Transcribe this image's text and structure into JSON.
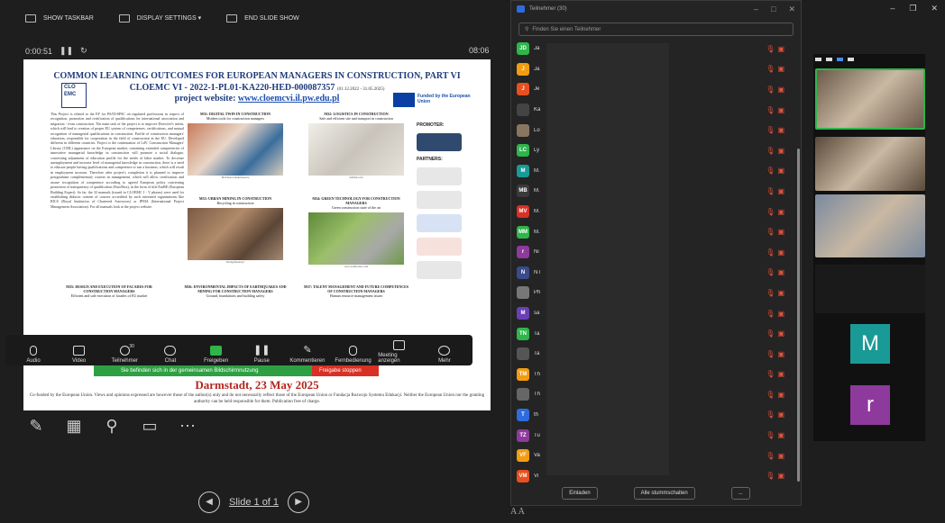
{
  "toolbar": {
    "show_taskbar": "SHOW TASKBAR",
    "display_settings": "DISPLAY SETTINGS ▾",
    "end_slide_show": "END SLIDE SHOW"
  },
  "timer": {
    "elapsed": "0:00:51",
    "clock": "08:06"
  },
  "slide": {
    "title": "COMMON LEARNING OUTCOMES FOR EUROPEAN MANAGERS IN CONSTRUCTION, PART VI",
    "subtitle": "CLOEMC VI - 2022-1-PL01-KA220-HED-000087357",
    "subtitle_dates": "(01.12.2022 - 31.05.2025)",
    "website_prefix": "project website: ",
    "website": "www.cloemcvi.il.pw.edu.pl",
    "logo_text": "CLO EMC",
    "eu_text": "Funded by the European Union",
    "body_text": "This Project is related to the EF for PS/05/SPSC on regulated professions in respect of recognition, promotion and certification of qualifications for international association and migration - from construction. The main task of the project is to improve Directive's intent, which will lead to creation of proper EU system of competences, certifications, and mutual recognition of managerial qualifications in construction. Profile of construction managers' education, responsible for cooperation in the field of construction in the EU. Developed different in different countries. Project is the continuation of LdV. Construction Managers' Library (CML) appearance on the European market, containing extended competencies of innovative managerial knowledge in construction will promote a social dialogue, concerning adjustment of education profile for the needs of labor market. To decrease unemployment and increase level of managerial knowledge in construction, there is a need to educate people having qualifications and competence to run a business, which will result in employment increase. Therefore after project's completion it is planned to improve postgraduate complementary courses in management, which will allow certification and assure recognition of competence according to agreed European policy concerning promotion of transparency of qualification (EuroPass), in the form of title EurBE (European Building Expert). So far, the 32 manuals (issued in CLOEMC I - V phases) were used for establishing didactic content of courses accredited by such esteemed organizations like RICS (Royal Institution of Chartered Surveyors) or IPMA (International Project Management Association). For all manuals look at the project website.",
    "modules": [
      {
        "title": "M31: DIGITAL TWIN IN CONSTRUCTION",
        "desc": "Modern tools for construction managers",
        "cap": "Mod/hezcottunkelseen.be"
      },
      {
        "title": "M32: LOGISTICS IN CONSTRUCTION",
        "desc": "Safe and efficient site and transport in construction",
        "cap": "unDark.com"
      },
      {
        "title": "M33: URBAN MINING IN CONSTRUCTION",
        "desc": "Recycling in construction",
        "cap": "Dredgemaster.pl"
      },
      {
        "title": "M34: GREEN TECHNOLOGY FOR CONSTRUCTION MANAGERS",
        "desc": "Green construction state of the art",
        "cap": "www.toddreview.com"
      },
      {
        "title": "M35: DESIGN AND EXECUTION OF FACADES FOR CONSTRUCTION MANAGERS",
        "desc": "Efficient and safe execution of facades of EU market",
        "cap": ""
      },
      {
        "title": "M36: ENVIRONMENTAL IMPACTS OF EARTHQUAKES AND MINING FOR CONSTRUCTION MANAGERS",
        "desc": "Ground, foundations and building safety",
        "cap": ""
      },
      {
        "title": "M37: TALENT MANAGEMENT AND FUTURE COMPETENCES OF CONSTRUCTION MANAGERS",
        "desc": "Human resource management issues",
        "cap": ""
      }
    ],
    "promoter_label": "PROMOTER:",
    "partners_label": "PARTNERS:",
    "date": "Darmstadt, 23 May 2025",
    "footer": "Co-funded by the European Union. Views and opinions expressed are however those of the author(s) only and do not necessarily reflect those of the European Union or Fundacja Rozwoju Systemu Edukacji. Neither the European Union nor the granting authority can be held responsible for them. Publication free of charge."
  },
  "meeting_bar": {
    "audio": "Audio",
    "video": "Video",
    "participants": "Teilnehmer",
    "participants_count": "30",
    "chat": "Chat",
    "share": "Freigeben",
    "pause": "Pause",
    "comment": "Kommentieren",
    "remote": "Fernbedienung",
    "show_meeting": "Meeting anzeigen",
    "more": "Mehr"
  },
  "share_notice": {
    "text": "Sie befinden sich in der gemeinsamen Bildschirmnutzung",
    "stop": "Freigabe stoppen"
  },
  "slide_nav": {
    "label": "Slide 1 of 1"
  },
  "font_size_labels": "A A",
  "participants_panel": {
    "title": "Teilnehmer (30)",
    "search_placeholder": "Finden Sie einen Teilnehmer",
    "invite": "Einladen",
    "mute_all": "Alle stummschalten",
    "more": "...",
    "participants": [
      {
        "initials": "JD",
        "name": "Ja",
        "color": "#2fb54a"
      },
      {
        "initials": "J",
        "name": "Ja",
        "color": "#f39c12"
      },
      {
        "initials": "J",
        "name": "Je",
        "color": "#e8501f"
      },
      {
        "initials": "",
        "name": "Ka",
        "color": "#444444"
      },
      {
        "initials": "",
        "name": "Lo",
        "color": "#8a7560"
      },
      {
        "initials": "LC",
        "name": "Ly",
        "color": "#2fb54a"
      },
      {
        "initials": "M",
        "name": "M.",
        "color": "#1a9a96"
      },
      {
        "initials": "MB",
        "name": "M.",
        "color": "#3a3a3a"
      },
      {
        "initials": "MV",
        "name": "M.",
        "color": "#d93025"
      },
      {
        "initials": "MM",
        "name": "M.",
        "color": "#2fb54a"
      },
      {
        "initials": "r",
        "name": "Ni",
        "color": "#8e3a9c"
      },
      {
        "initials": "N",
        "name": "NT",
        "color": "#3a4a8a"
      },
      {
        "initials": "",
        "name": "Ph",
        "color": "#777777"
      },
      {
        "initials": "M",
        "name": "sa",
        "color": "#6a3fb5"
      },
      {
        "initials": "TN",
        "name": "Ta",
        "color": "#2fb54a"
      },
      {
        "initials": "",
        "name": "Ta",
        "color": "#555555"
      },
      {
        "initials": "TM",
        "name": "Th",
        "color": "#f39c12"
      },
      {
        "initials": "",
        "name": "Th",
        "color": "#666666"
      },
      {
        "initials": "T",
        "name": "th",
        "color": "#2d6cdf"
      },
      {
        "initials": "TZ",
        "name": "Tu",
        "color": "#8e3a9c"
      },
      {
        "initials": "VF",
        "name": "Va",
        "color": "#f39c12"
      },
      {
        "initials": "VM",
        "name": "Vi",
        "color": "#e8501f"
      }
    ]
  },
  "gallery": {
    "tiles": [
      {
        "initial": "",
        "color": "#6b5a4a"
      },
      {
        "initial": "",
        "color": "#5a4a3a"
      },
      {
        "initial": "",
        "color": "#7a8aa0"
      },
      {
        "initial": "",
        "color": "#1a1a1a"
      },
      {
        "initial": "M",
        "color": "#1a9a96"
      },
      {
        "initial": "r",
        "color": "#8e3a9c"
      }
    ]
  },
  "colors": {
    "accent_green": "#2ea043",
    "stop_red": "#d93025",
    "title_blue": "#1f3a7a",
    "date_red": "#b3261e",
    "muted_icon": "#e0533a"
  }
}
